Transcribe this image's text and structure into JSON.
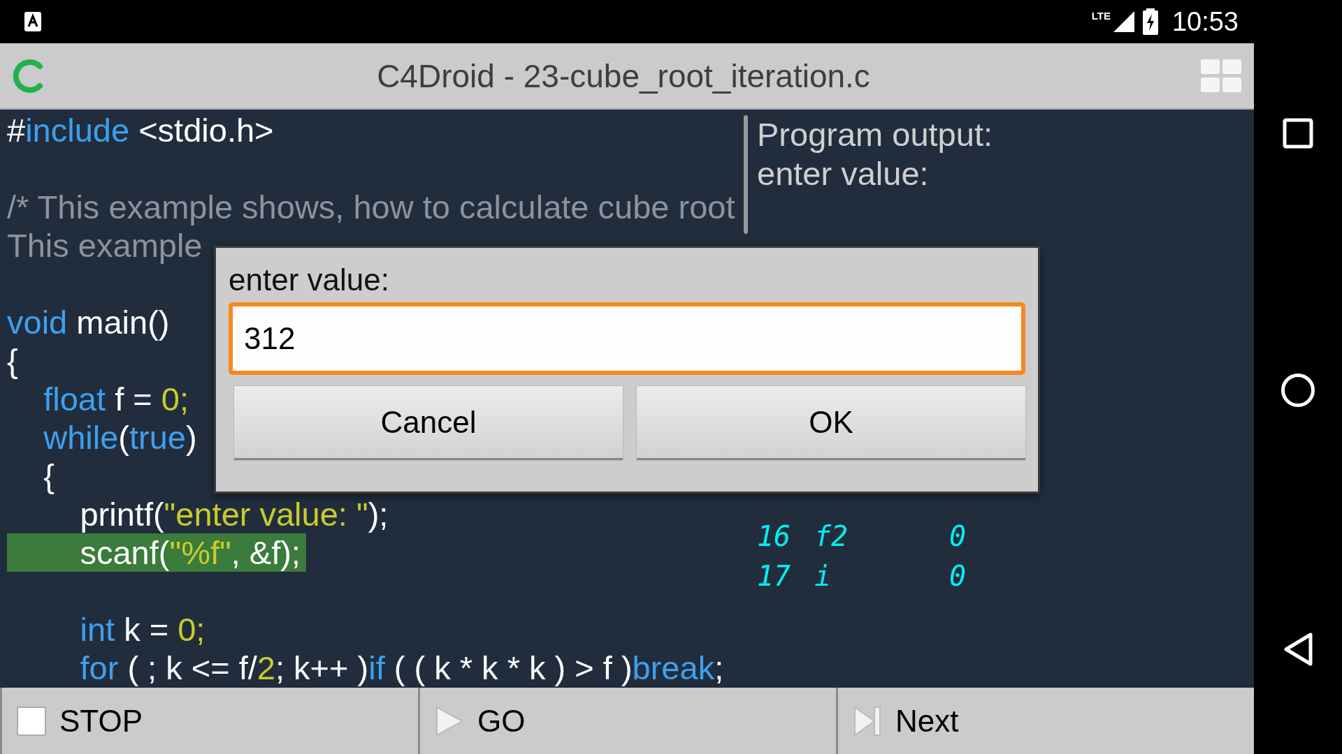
{
  "status_bar": {
    "network": "LTE",
    "time": "10:53"
  },
  "title_bar": {
    "title": "C4Droid - 23-cube_root_iteration.c"
  },
  "editor": {
    "lines": [
      {
        "kind": "code",
        "highlighted": false,
        "tokens": [
          {
            "kind": "plain",
            "text": "#"
          },
          {
            "kind": "keyword",
            "text": "include"
          },
          {
            "kind": "plain",
            "text": " <stdio.h>"
          }
        ]
      },
      {
        "kind": "blank"
      },
      {
        "kind": "code",
        "highlighted": false,
        "tokens": [
          {
            "kind": "comment",
            "text": "/* This example shows, how to calculate cube root"
          }
        ]
      },
      {
        "kind": "code",
        "highlighted": false,
        "tokens": [
          {
            "kind": "comment",
            "text": "This example"
          }
        ]
      },
      {
        "kind": "blank"
      },
      {
        "kind": "code",
        "highlighted": false,
        "tokens": [
          {
            "kind": "keyword",
            "text": "void"
          },
          {
            "kind": "plain",
            "text": " main()"
          }
        ]
      },
      {
        "kind": "code",
        "highlighted": false,
        "tokens": [
          {
            "kind": "plain",
            "text": "{"
          }
        ]
      },
      {
        "kind": "code",
        "highlighted": false,
        "tokens": [
          {
            "kind": "keyword",
            "text": "    float"
          },
          {
            "kind": "plain",
            "text": " f = "
          },
          {
            "kind": "number",
            "text": "0;"
          }
        ]
      },
      {
        "kind": "code",
        "highlighted": false,
        "tokens": [
          {
            "kind": "keyword",
            "text": "    while"
          },
          {
            "kind": "plain",
            "text": "("
          },
          {
            "kind": "keyword",
            "text": "true"
          },
          {
            "kind": "plain",
            "text": ")"
          }
        ]
      },
      {
        "kind": "code",
        "highlighted": false,
        "tokens": [
          {
            "kind": "plain",
            "text": "    {"
          }
        ]
      },
      {
        "kind": "code",
        "highlighted": false,
        "tokens": [
          {
            "kind": "plain",
            "text": "        printf("
          },
          {
            "kind": "string",
            "text": "\"enter value: \""
          },
          {
            "kind": "plain",
            "text": ");"
          }
        ]
      },
      {
        "kind": "code",
        "highlighted": true,
        "tokens": [
          {
            "kind": "plain",
            "text": "        scanf("
          },
          {
            "kind": "string",
            "text": "\"%f\""
          },
          {
            "kind": "plain",
            "text": ", &f);"
          }
        ]
      },
      {
        "kind": "blank"
      },
      {
        "kind": "code",
        "highlighted": false,
        "tokens": [
          {
            "kind": "keyword",
            "text": "        int"
          },
          {
            "kind": "plain",
            "text": " k = "
          },
          {
            "kind": "number",
            "text": "0;"
          }
        ]
      },
      {
        "kind": "code",
        "highlighted": false,
        "tokens": [
          {
            "kind": "keyword",
            "text": "        for"
          },
          {
            "kind": "plain",
            "text": " ( ; k <= f/"
          },
          {
            "kind": "number",
            "text": "2"
          },
          {
            "kind": "plain",
            "text": "; k++ )"
          },
          {
            "kind": "keyword",
            "text": "if"
          },
          {
            "kind": "plain",
            "text": " ( ( k * k * k ) > f )"
          },
          {
            "kind": "keyword",
            "text": "break"
          },
          {
            "kind": "plain",
            "text": ";"
          }
        ]
      }
    ]
  },
  "output": {
    "heading": "Program output:",
    "lines": [
      "enter value:"
    ],
    "variables": [
      {
        "index": "16",
        "name": "f2",
        "value": "0"
      },
      {
        "index": "17",
        "name": "i",
        "value": "0"
      }
    ]
  },
  "dialog": {
    "label": "enter value:",
    "value": "312",
    "buttons": [
      {
        "label": "Cancel"
      },
      {
        "label": "OK"
      }
    ]
  },
  "toolbar": [
    {
      "kind": "stop",
      "label": "STOP"
    },
    {
      "kind": "go",
      "label": "GO"
    },
    {
      "kind": "next",
      "label": "Next"
    }
  ]
}
